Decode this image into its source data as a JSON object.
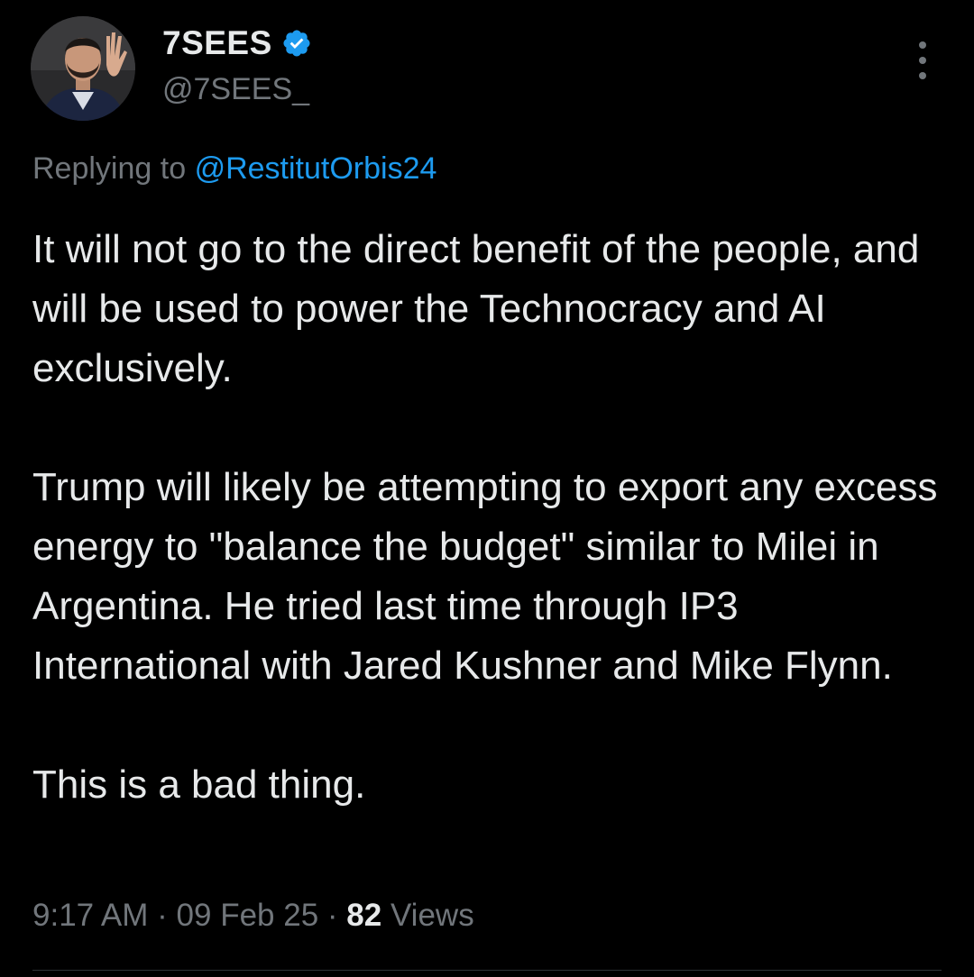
{
  "author": {
    "display_name": "7SEES",
    "handle": "@7SEES_",
    "verified_icon": "verified-badge-icon"
  },
  "reply": {
    "prefix": "Replying to",
    "mention": "@RestitutOrbis24"
  },
  "body": {
    "paragraph_1": "It will not go to the direct benefit of the people, and will be used to power the Technocracy and AI exclusively.",
    "paragraph_2": "Trump will likely be attempting to export any excess energy to \"balance the budget\" similar to Milei in Argentina. He tried last time through IP3 International with Jared Kushner and Mike Flynn.",
    "paragraph_3": "This is a bad thing."
  },
  "meta": {
    "time": "9:17 AM",
    "separator": "·",
    "date": "09 Feb 25",
    "views_count": "82",
    "views_label": "Views"
  },
  "colors": {
    "background": "#000000",
    "text": "#e7e9ea",
    "secondary": "#71767b",
    "accent": "#1d9bf0"
  },
  "icons": {
    "more": "more-dots-icon"
  }
}
